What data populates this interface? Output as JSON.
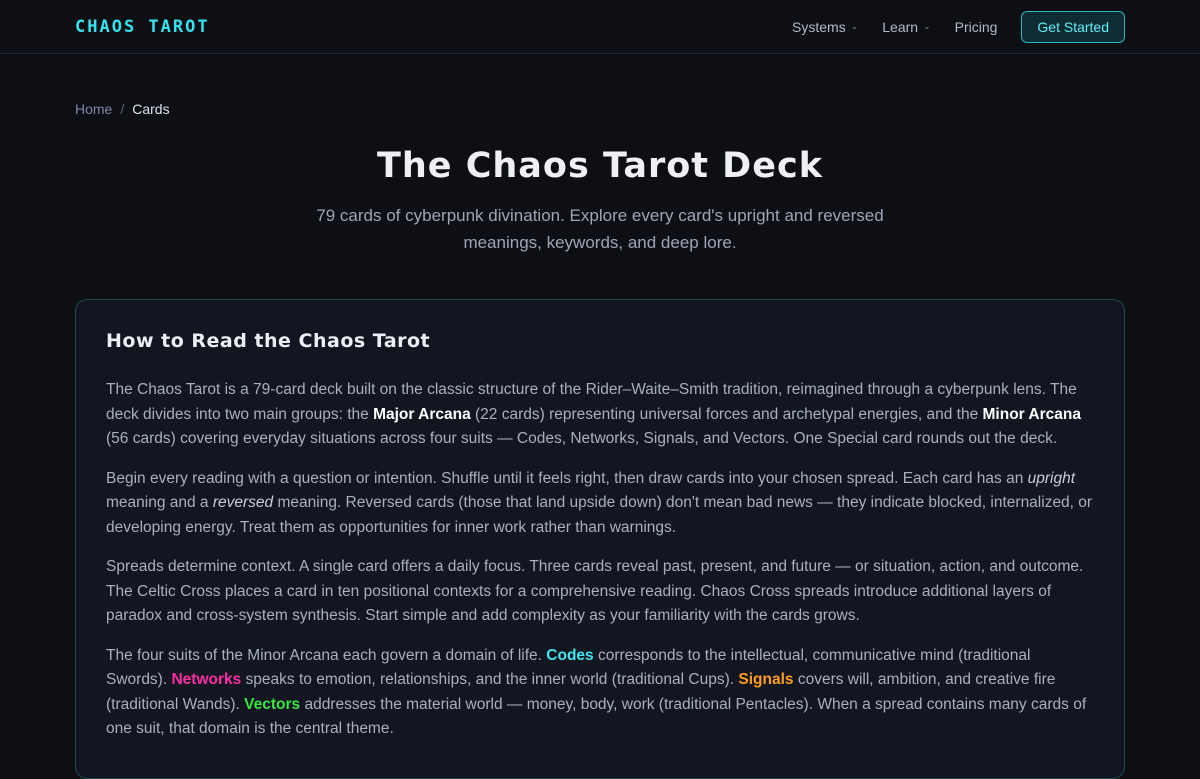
{
  "brand": {
    "logo": "CHAOS TAROT"
  },
  "nav": {
    "items": [
      {
        "label": "Systems",
        "has_dropdown": true
      },
      {
        "label": "Learn",
        "has_dropdown": true
      },
      {
        "label": "Pricing",
        "has_dropdown": false
      }
    ],
    "cta_label": "Get Started"
  },
  "breadcrumb": {
    "home": "Home",
    "separator": "/",
    "current": "Cards"
  },
  "hero": {
    "title": "The Chaos Tarot Deck",
    "subtitle": "79 cards of cyberpunk divination. Explore every card's upright and reversed meanings, keywords, and deep lore."
  },
  "guide": {
    "title": "How to Read the Chaos Tarot",
    "p1": {
      "a": "The Chaos Tarot is a 79-card deck built on the classic structure of the Rider–Waite–Smith tradition, reimagined through a cyberpunk lens. The deck divides into two main groups: the ",
      "major": "Major Arcana",
      "b": " (22 cards) representing universal forces and archetypal energies, and the ",
      "minor": "Minor Arcana",
      "c": " (56 cards) covering everyday situations across four suits — Codes, Networks, Signals, and Vectors. One Special card rounds out the deck."
    },
    "p2": {
      "a": "Begin every reading with a question or intention. Shuffle until it feels right, then draw cards into your chosen spread. Each card has an ",
      "upright": "upright",
      "b": " meaning and a ",
      "reversed": "reversed",
      "c": " meaning. Reversed cards (those that land upside down) don't mean bad news — they indicate blocked, internalized, or developing energy. Treat them as opportunities for inner work rather than warnings."
    },
    "p3": "Spreads determine context. A single card offers a daily focus. Three cards reveal past, present, and future — or situation, action, and outcome. The Celtic Cross places a card in ten positional contexts for a comprehensive reading. Chaos Cross spreads introduce additional layers of paradox and cross-system synthesis. Start simple and add complexity as your familiarity with the cards grows.",
    "p4": {
      "a": "The four suits of the Minor Arcana each govern a domain of life. ",
      "codes": "Codes",
      "b": " corresponds to the intellectual, communicative mind (traditional Swords). ",
      "networks": "Networks",
      "c": " speaks to emotion, relationships, and the inner world (traditional Cups). ",
      "signals": "Signals",
      "d": " covers will, ambition, and creative fire (traditional Wands). ",
      "vectors": "Vectors",
      "e": " addresses the material world — money, body, work (traditional Pentacles). When a spread contains many cards of one suit, that domain is the central theme."
    }
  },
  "colors": {
    "background": "#0d0f14",
    "accent": "#35e3ee",
    "codes": "#3fe6f0",
    "networks": "#ff2ea3",
    "signals": "#ff9f1c",
    "vectors": "#39e642"
  }
}
